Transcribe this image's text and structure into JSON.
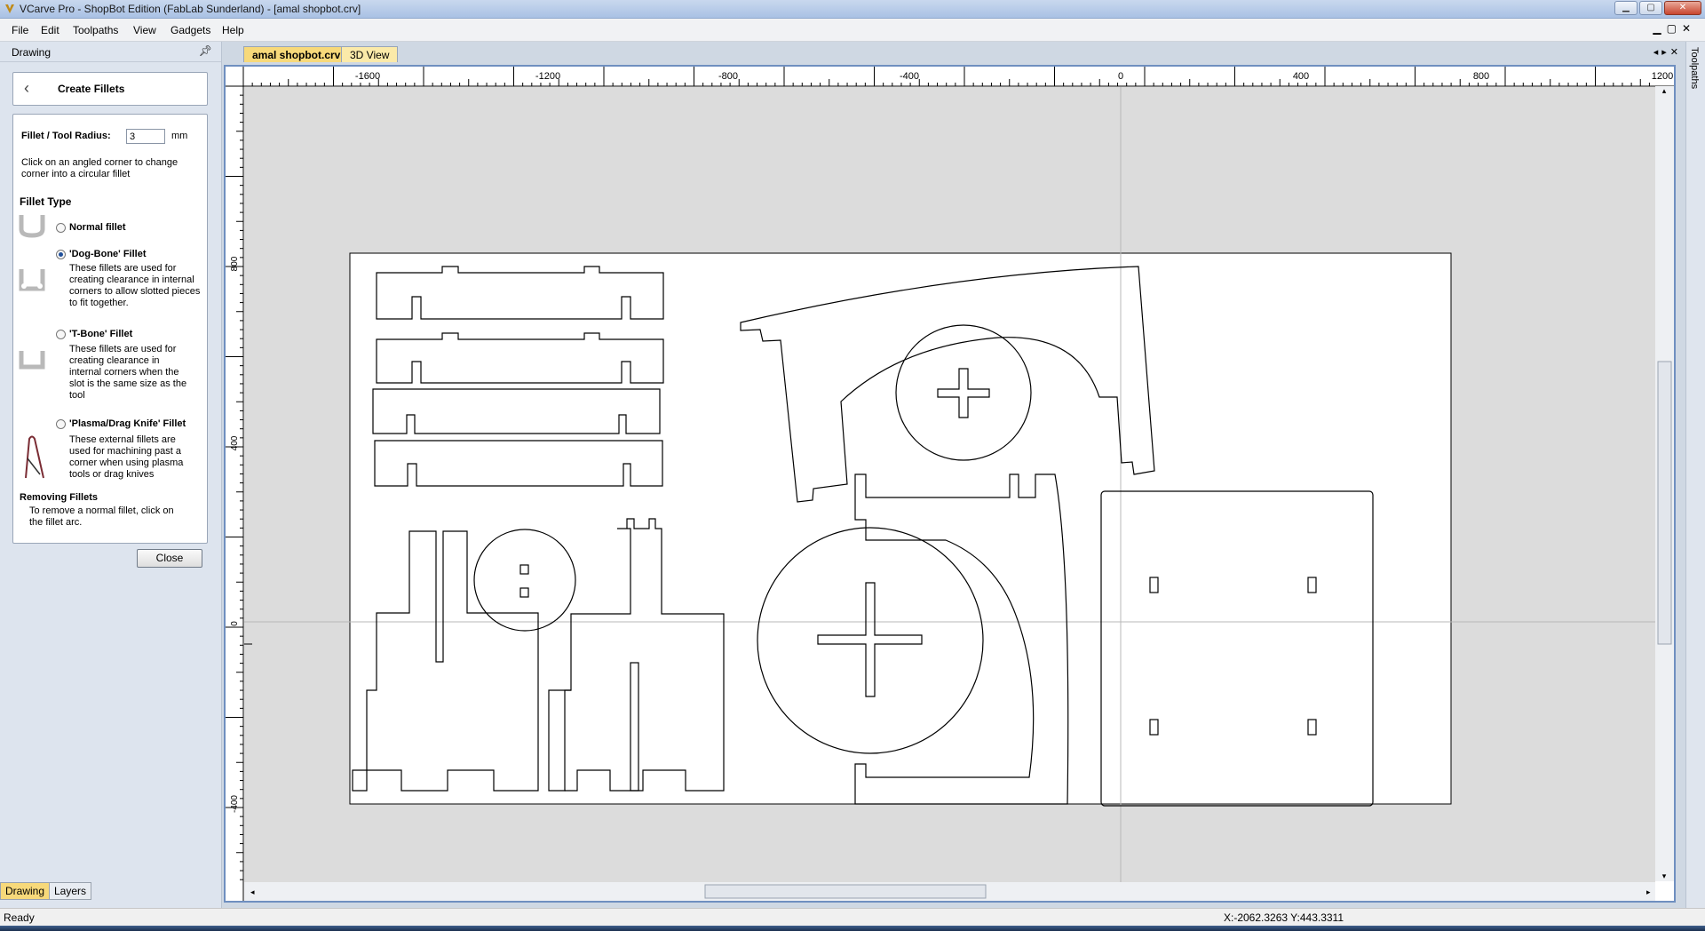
{
  "window": {
    "title": "VCarve Pro - ShopBot Edition (FabLab Sunderland) - [amal shopbot.crv]"
  },
  "menu": [
    "File",
    "Edit",
    "Toolpaths",
    "View",
    "Gadgets",
    "Help"
  ],
  "left_panel": {
    "header": "Drawing",
    "form_title": "Create Fillets",
    "radius_label": "Fillet / Tool Radius:",
    "radius_value": "3",
    "radius_unit": "mm",
    "hint": "Click on an angled corner to change corner into a circular fillet",
    "fillet_type_heading": "Fillet Type",
    "options": [
      {
        "label": "Normal fillet",
        "desc": "",
        "selected": false
      },
      {
        "label": "'Dog-Bone' Fillet",
        "desc": "These fillets are used for creating clearance in internal corners to allow slotted pieces to fit together.",
        "selected": true
      },
      {
        "label": "'T-Bone' Fillet",
        "desc": "These fillets are used for creating clearance in internal corners when the slot is the same size as the tool",
        "selected": false
      },
      {
        "label": "'Plasma/Drag Knife' Fillet",
        "desc": "These external fillets are used for machining past a corner when using plasma tools or drag knives",
        "selected": false
      }
    ],
    "removing_heading": "Removing Fillets",
    "removing_text": "To remove a normal fillet, click on the fillet arc.",
    "close_button": "Close",
    "bottom_tabs": [
      "Drawing",
      "Layers"
    ]
  },
  "doc_tabs": [
    "amal shopbot.crv",
    "3D View"
  ],
  "ruler": {
    "top_labels": [
      "-1600",
      "-1200",
      "-800",
      "-400",
      "0",
      "400",
      "800",
      "1200"
    ],
    "left_labels": [
      "800",
      "400",
      "0",
      "-400"
    ]
  },
  "right_strip": "Toolpaths",
  "status": {
    "left": "Ready",
    "coords": "X:-2062.3263 Y:443.3311"
  },
  "colors": {
    "accent_tab": "#f7d97a",
    "frame": "#6f8fc0",
    "canvas_bg": "#dcdcdc"
  }
}
